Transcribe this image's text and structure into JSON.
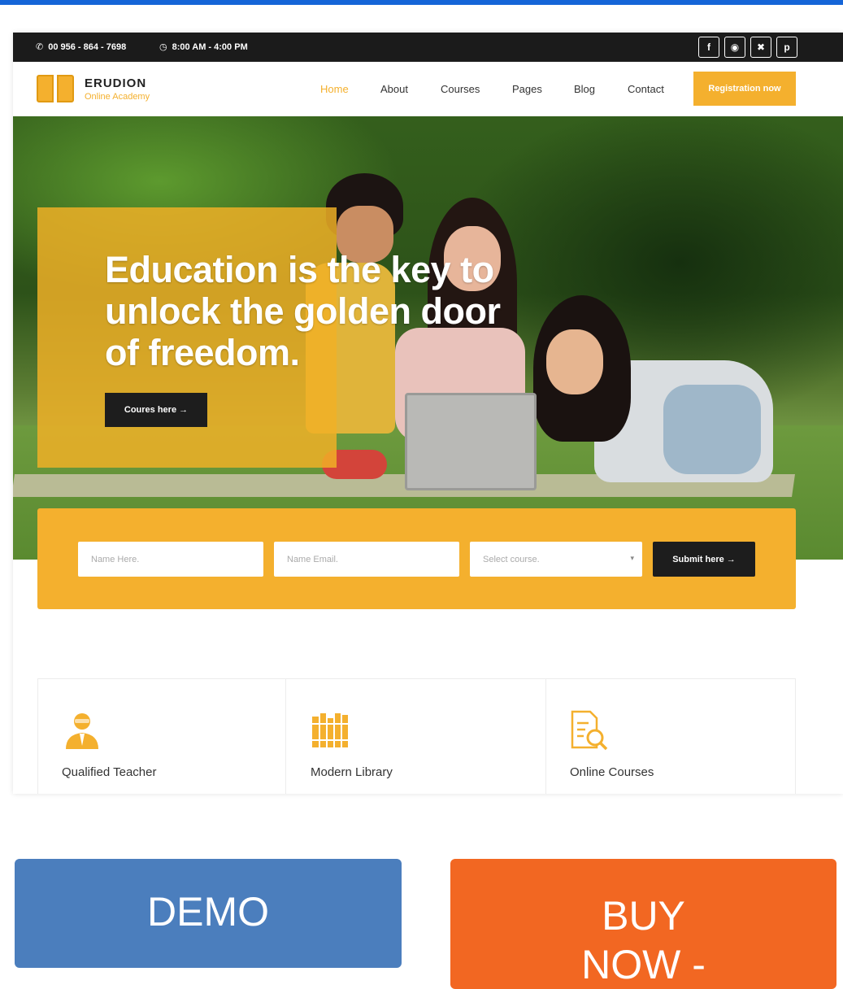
{
  "topbar": {
    "phone": "00 956 - 864 - 7698",
    "hours": "8:00 AM - 4:00 PM",
    "socials": [
      "f",
      "in",
      "t",
      "p"
    ]
  },
  "header": {
    "brand": "ERUDION",
    "tagline": "Online Academy",
    "nav": [
      "Home",
      "About",
      "Courses",
      "Pages",
      "Blog",
      "Contact"
    ],
    "register_label": "Registration now"
  },
  "hero": {
    "headline": "Education is the key to unlock the golden door of freedom.",
    "course_button": "Coures here →"
  },
  "form": {
    "name_placeholder": "Name Here.",
    "email_placeholder": "Name Email.",
    "course_placeholder": "Select course.",
    "submit_label": "Submit here →"
  },
  "features": [
    {
      "label": "Qualified Teacher",
      "icon": "teacher-icon"
    },
    {
      "label": "Modern Library",
      "icon": "library-icon"
    },
    {
      "label": "Online Courses",
      "icon": "document-search-icon"
    }
  ],
  "actions": {
    "demo_label": "DEMO",
    "buy_label": "BUY NOW -"
  },
  "colors": {
    "accent": "#f4b02e",
    "dark": "#1d1d1d",
    "demo": "#4b7ebd",
    "buy": "#f26722"
  }
}
